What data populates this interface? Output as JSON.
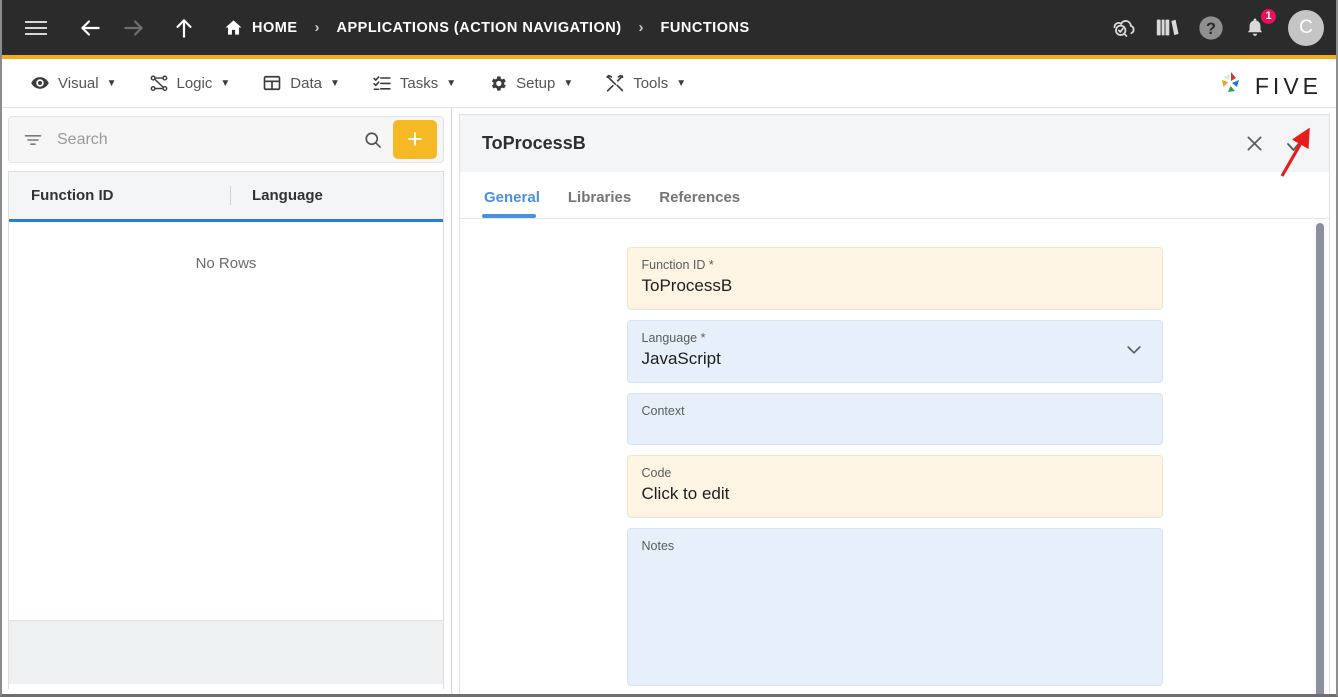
{
  "topbar": {
    "menu_icon": "hamburger-icon",
    "back_icon": "arrow-left-icon",
    "forward_icon": "arrow-right-icon",
    "up_icon": "arrow-up-icon",
    "breadcrumbs": [
      {
        "label": "HOME",
        "icon": "home-icon"
      },
      {
        "label": "APPLICATIONS (ACTION NAVIGATION)",
        "icon": ""
      },
      {
        "label": "FUNCTIONS",
        "icon": ""
      }
    ],
    "separator": "›",
    "actions": [
      {
        "name": "cloud-check-icon"
      },
      {
        "name": "books-icon"
      },
      {
        "name": "help-icon"
      },
      {
        "name": "bell-icon",
        "badge": "1"
      }
    ],
    "avatar_letter": "C",
    "badge_color": "#e8115b",
    "background": "#2b2b2b"
  },
  "accent_color": "#f0ad1e",
  "menubar": {
    "items": [
      {
        "label": "Visual",
        "icon": "eye-icon",
        "caret": "▼"
      },
      {
        "label": "Logic",
        "icon": "logic-nodes-icon",
        "caret": "▼"
      },
      {
        "label": "Data",
        "icon": "table-icon",
        "caret": "▼"
      },
      {
        "label": "Tasks",
        "icon": "checklist-icon",
        "caret": "▼"
      },
      {
        "label": "Setup",
        "icon": "gear-icon",
        "caret": "▼"
      },
      {
        "label": "Tools",
        "icon": "tools-icon",
        "caret": "▼"
      }
    ],
    "logo_text": "FIVE"
  },
  "sidebar": {
    "search": {
      "placeholder": "Search",
      "value": "",
      "filter_icon": "filter-icon",
      "search_icon": "search-icon"
    },
    "add_button_label": "+",
    "add_button_color": "#f5b926",
    "grid": {
      "columns": [
        "Function ID",
        "Language"
      ],
      "rows": [],
      "empty_text": "No Rows",
      "header_underline_color": "#2a7fd4"
    }
  },
  "detail": {
    "title": "ToProcessB",
    "close_label": "✕",
    "confirm_label": "✓",
    "tabs": [
      {
        "label": "General",
        "active": true
      },
      {
        "label": "Libraries",
        "active": false
      },
      {
        "label": "References",
        "active": false
      }
    ],
    "active_tab_color": "#4a90e2",
    "fields": [
      {
        "label": "Function ID",
        "required": true,
        "value": "ToProcessB",
        "style": "cream",
        "kind": "text"
      },
      {
        "label": "Language",
        "required": true,
        "value": "JavaScript",
        "style": "blue",
        "kind": "select"
      },
      {
        "label": "Context",
        "required": false,
        "value": "",
        "style": "blue",
        "kind": "text"
      },
      {
        "label": "Code",
        "required": false,
        "value": "Click to edit",
        "style": "cream",
        "kind": "text"
      },
      {
        "label": "Notes",
        "required": false,
        "value": "",
        "style": "blue",
        "kind": "textarea"
      }
    ]
  },
  "annotation": {
    "type": "red-arrow",
    "points_to": "confirm-button",
    "color": "#e81c1c"
  }
}
